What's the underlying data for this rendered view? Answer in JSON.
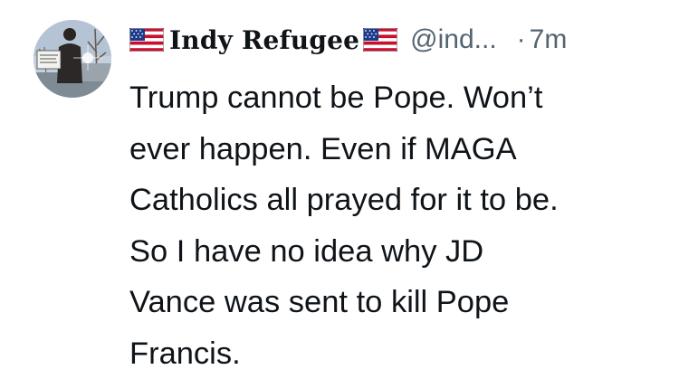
{
  "author": {
    "display_name": "Indy Refugee",
    "name_flag_before": "us-flag-icon",
    "name_flag_after": "us-flag-icon",
    "handle": "@ind...",
    "separator": "·",
    "time": "7m"
  },
  "tweet": {
    "lines": [
      "Trump cannot be Pope. Won’t",
      "ever happen. Even if MAGA",
      "Catholics all prayed for it to be.",
      "So I have no idea why JD",
      "Vance was sent to kill Pope",
      "Francis."
    ]
  },
  "colors": {
    "text": "#0f1419",
    "secondary": "#536471",
    "background": "#ffffff"
  }
}
